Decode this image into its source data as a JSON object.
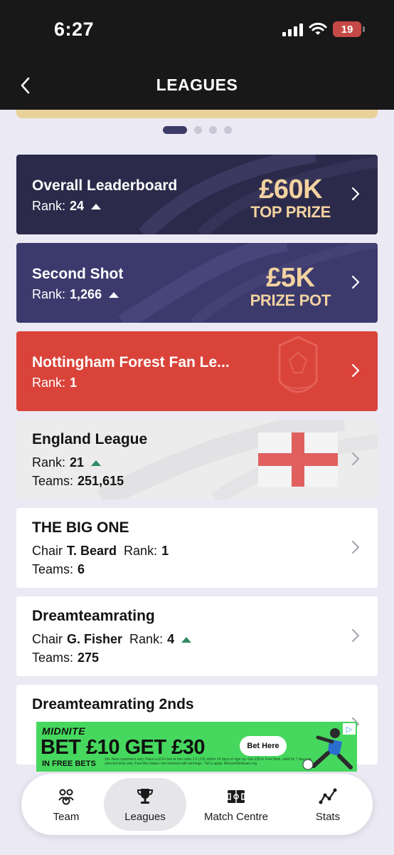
{
  "status_bar": {
    "time": "6:27",
    "battery": "19"
  },
  "header": {
    "title": "LEAGUES"
  },
  "carousel": {
    "dots": 4,
    "active_index": 0
  },
  "leagues": [
    {
      "title": "Overall Leaderboard",
      "rank_label": "Rank:",
      "rank": "24",
      "rank_trend": "up",
      "prize_amount": "£60K",
      "prize_label": "TOP PRIZE"
    },
    {
      "title": "Second Shot",
      "rank_label": "Rank:",
      "rank": "1,266",
      "rank_trend": "up",
      "prize_amount": "£5K",
      "prize_label": "PRIZE POT"
    },
    {
      "title": "Nottingham Forest Fan Le...",
      "rank_label": "Rank:",
      "rank": "1"
    },
    {
      "title": "England League",
      "rank_label": "Rank:",
      "rank": "21",
      "rank_trend": "up",
      "teams_label": "Teams:",
      "teams": "251,615"
    },
    {
      "title": "THE BIG ONE",
      "chair_label": "Chair",
      "chair": "T. Beard",
      "rank_label": "Rank:",
      "rank": "1",
      "teams_label": "Teams:",
      "teams": "6"
    },
    {
      "title": "Dreamteamrating",
      "chair_label": "Chair",
      "chair": "G. Fisher",
      "rank_label": "Rank:",
      "rank": "4",
      "rank_trend": "up",
      "teams_label": "Teams:",
      "teams": "275"
    },
    {
      "title": "Dreamteamrating 2nds"
    }
  ],
  "ad": {
    "brand": "MIDNITE",
    "headline": "BET £10 GET £30",
    "subline": "IN FREE BETS",
    "button": "Bet Here",
    "fine_print": "18+ New customers only. Place a £10+ bet at min odds 1.5 (1/2) within 14 days of sign up. Get £30 in Free Bets, valid for 7 days on selected bets only. Free Bet stakes not returned with winnings. T&Cs apply. BeGambleAware.org"
  },
  "nav": [
    {
      "label": "Team",
      "icon": "team-icon",
      "active": false
    },
    {
      "label": "Leagues",
      "icon": "trophy-icon",
      "active": true
    },
    {
      "label": "Match Centre",
      "icon": "pitch-icon",
      "active": false
    },
    {
      "label": "Stats",
      "icon": "stats-icon",
      "active": false
    }
  ],
  "colors": {
    "overall_card": "#2c2a4a",
    "second_shot_card": "#3c3a6d",
    "forest_card": "#d9433a",
    "prize_text": "#f2d2a0",
    "trend_up_green": "#2f8c60",
    "ad_green": "#46d85e"
  }
}
